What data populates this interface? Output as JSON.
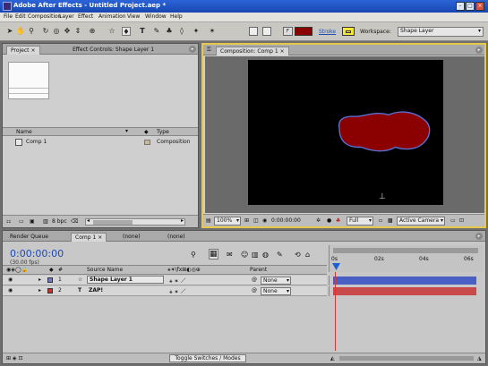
{
  "window": {
    "title": "Adobe After Effects - Untitled Project.aep *"
  },
  "menu": [
    "File",
    "Edit",
    "Composition",
    "Layer",
    "Effect",
    "Animation",
    "View",
    "Window",
    "Help"
  ],
  "toolbar": {
    "tools": [
      "selection-icon",
      "hand-icon",
      "zoom-icon",
      "rotate-icon",
      "orbit-camera-icon",
      "track-xy-icon",
      "track-z-icon",
      "pan-behind-icon",
      "rectangle-mask-icon",
      "pen-icon",
      "text-icon",
      "brush-icon",
      "clone-stamp-icon",
      "eraser-icon",
      "roto-brush-icon",
      "puppet-icon"
    ],
    "fill_color": "#8a0000",
    "stroke_label": "Stroke",
    "workspace_label": "Workspace:",
    "workspace_value": "Shape Layer"
  },
  "project_panel": {
    "tabs": [
      "Project",
      "Effect Controls: Shape Layer 1"
    ],
    "columns": {
      "name": "Name",
      "type": "Type"
    },
    "items": [
      {
        "name": "Comp 1",
        "type": "Composition"
      }
    ],
    "bpc": "8 bpc"
  },
  "composition_panel": {
    "tab": "Composition: Comp 1",
    "background": "#000000",
    "shape_fill": "#8b0000",
    "shape_stroke": "#5a6fd0",
    "zoom": "100%",
    "timecode": "0:00:00:00",
    "resolution": "Full",
    "view": "Active Camera"
  },
  "timeline": {
    "tabs": [
      "Render Queue",
      "Comp 1",
      "(none)",
      "(none)"
    ],
    "timecode": "0:00:00:00",
    "fps": "(30.00 fps)",
    "headers": {
      "source_name": "Source Name",
      "parent": "Parent"
    },
    "layers": [
      {
        "num": "1",
        "label_color": "#6d7ad0",
        "icon": "☆",
        "name": "Shape Layer 1",
        "parent": "None",
        "bar_color": "#4a5fc4"
      },
      {
        "num": "2",
        "label_color": "#c83030",
        "icon": "T",
        "name": "ZAP!",
        "parent": "None",
        "bar_color": "#c84a4a"
      }
    ],
    "ruler": [
      "0s",
      "02s",
      "04s",
      "06s"
    ],
    "toggle_label": "Toggle Switches / Modes"
  }
}
